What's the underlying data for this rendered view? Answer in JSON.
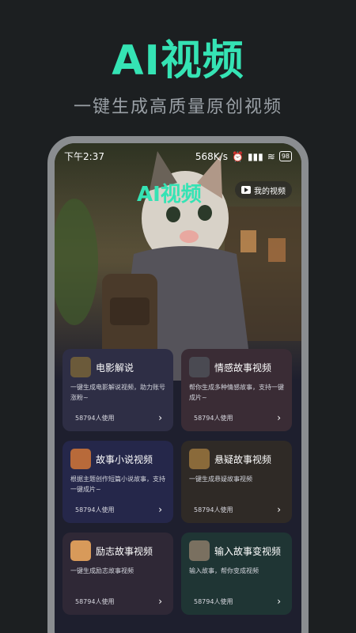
{
  "promo": {
    "title": "AI视频",
    "subtitle": "一键生成高质量原创视频"
  },
  "status_bar": {
    "time": "下午2:37",
    "net_speed": "568K/s",
    "battery": "98"
  },
  "header": {
    "title": "AI视频",
    "my_videos_label": "我的视频"
  },
  "cards": [
    {
      "title": "电影解说",
      "desc": "一键生成电影解说视频，助力账号涨粉~",
      "usage": "58794人使用",
      "thumb_color": "#6b5a3a"
    },
    {
      "title": "情感故事视频",
      "desc": "帮你生成多种情感故事，支持一键成片~",
      "usage": "58794人使用",
      "thumb_color": "#4a4a52"
    },
    {
      "title": "故事小说视频",
      "desc": "根据主题创作短篇小说故事，支持一键成片~",
      "usage": "58794人使用",
      "thumb_color": "#b86a3a"
    },
    {
      "title": "悬疑故事视频",
      "desc": "一键生成悬疑故事视频",
      "usage": "58794人使用",
      "thumb_color": "#8a6a3a"
    },
    {
      "title": "励志故事视频",
      "desc": "一键生成励志故事视频",
      "usage": "58794人使用",
      "thumb_color": "#d89a5a"
    },
    {
      "title": "输入故事变视频",
      "desc": "输入故事，帮你变成视频",
      "usage": "58794人使用",
      "thumb_color": "#7a7060"
    }
  ],
  "colors": {
    "accent": "#35e3b4",
    "background": "#1c1f21"
  }
}
